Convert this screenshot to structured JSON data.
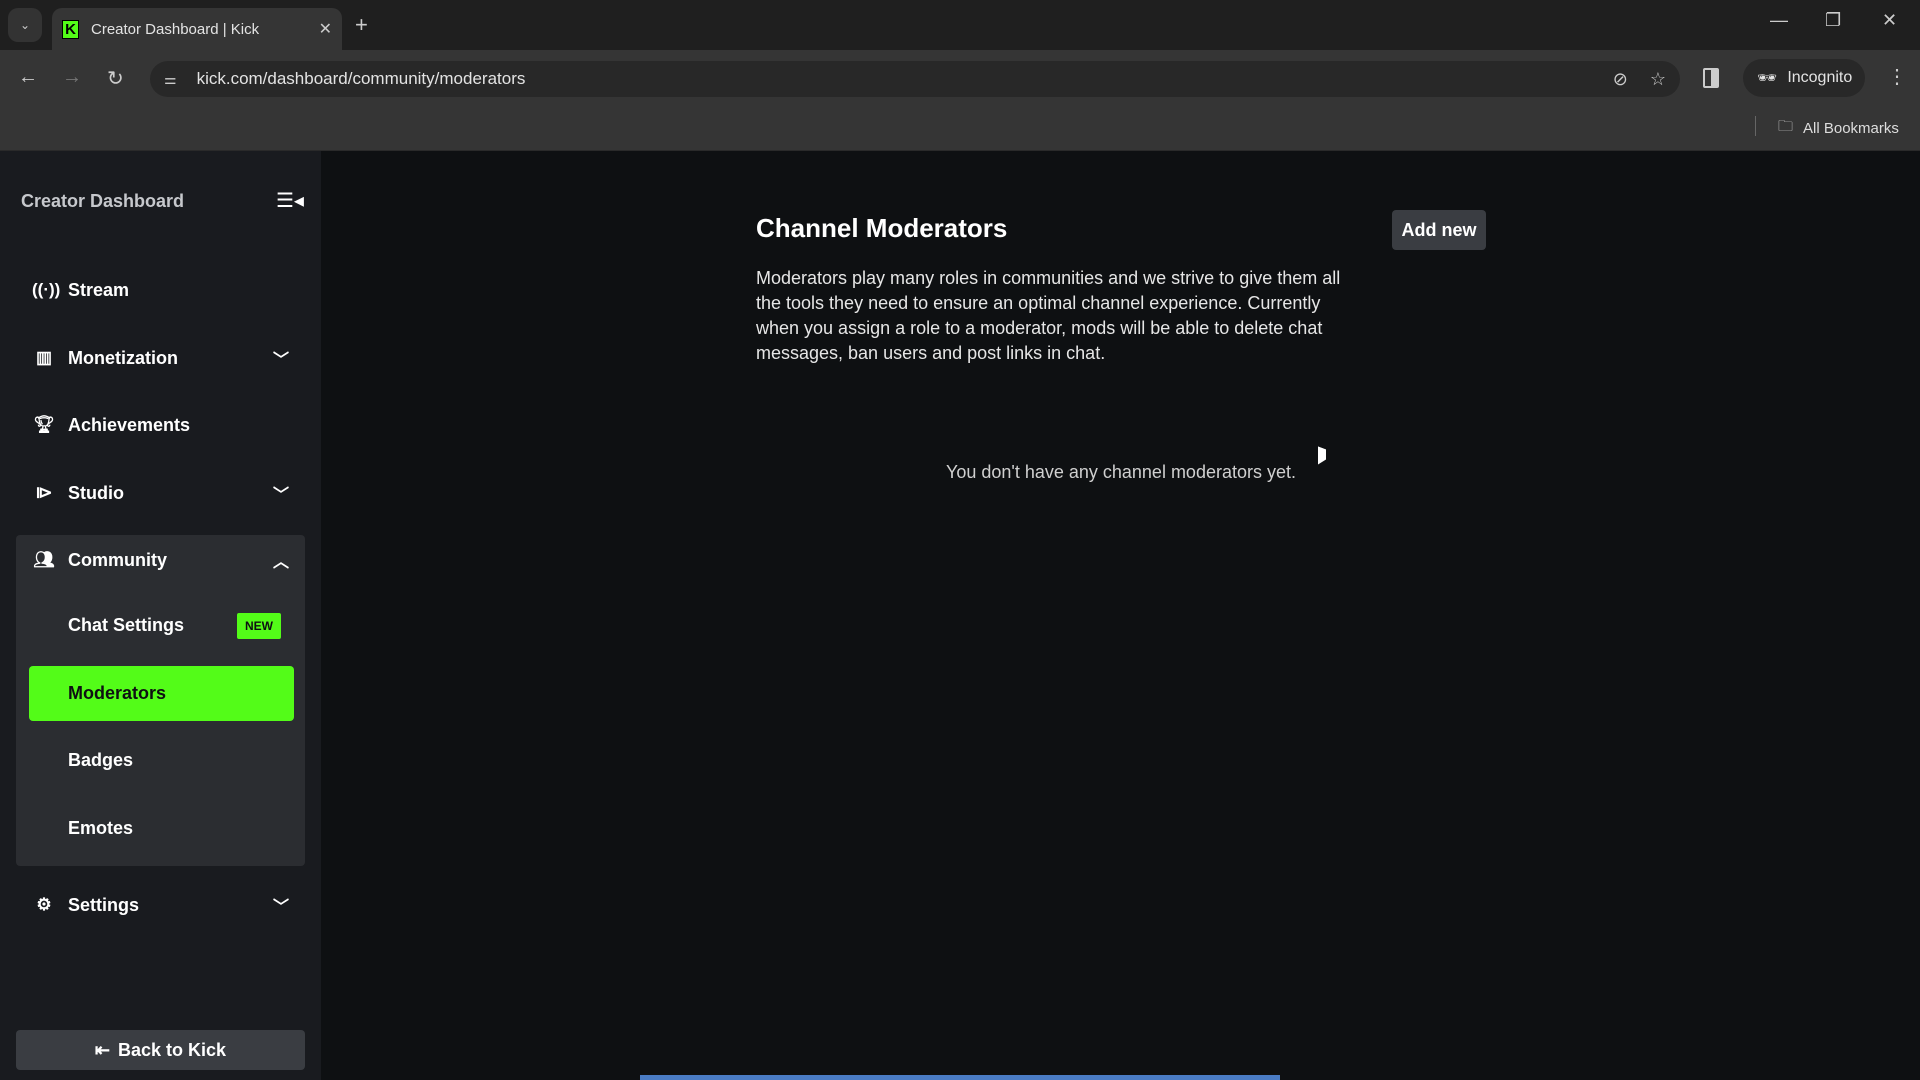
{
  "browser": {
    "tab_title": "Creator Dashboard | Kick",
    "favicon_letter": "K",
    "url": "kick.com/dashboard/community/moderators",
    "incognito_label": "Incognito",
    "bookmarks_label": "All Bookmarks"
  },
  "colors": {
    "accent": "#53fc18",
    "sidebar_bg": "#191b1f",
    "main_bg": "#0e1012",
    "progress": "#4a7cc4"
  },
  "sidebar": {
    "title": "Creator Dashboard",
    "items": [
      {
        "label": "Stream",
        "icon": "broadcast-icon"
      },
      {
        "label": "Monetization",
        "icon": "chart-icon"
      },
      {
        "label": "Achievements",
        "icon": "trophy-icon"
      },
      {
        "label": "Studio",
        "icon": "studio-icon"
      },
      {
        "label": "Community",
        "icon": "users-icon"
      },
      {
        "label": "Settings",
        "icon": "gear-icon"
      }
    ],
    "community_sub": [
      {
        "label": "Chat Settings",
        "badge": "NEW"
      },
      {
        "label": "Moderators",
        "active": true
      },
      {
        "label": "Badges"
      },
      {
        "label": "Emotes"
      }
    ],
    "back_label": "Back to Kick"
  },
  "main": {
    "title": "Channel Moderators",
    "add_button": "Add new",
    "description": "Moderators play many roles in communities and we strive to give them all the tools they need to ensure an optimal channel experience. Currently when you assign a role to a moderator, mods will be able to delete chat messages, ban users and post links in chat.",
    "empty_message": "You don't have any channel moderators yet."
  }
}
